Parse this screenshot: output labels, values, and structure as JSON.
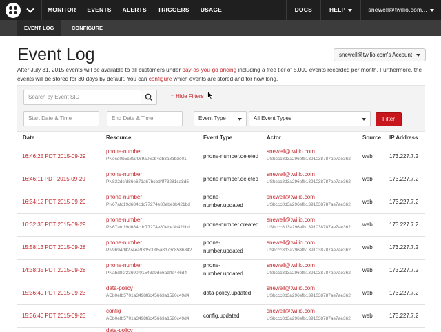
{
  "nav": {
    "items": [
      "MONITOR",
      "EVENTS",
      "ALERTS",
      "TRIGGERS",
      "USAGE"
    ],
    "docs": "DOCS",
    "help": "HELP",
    "user": "snewell@twilio.com..."
  },
  "subnav": {
    "event_log": "EVENT LOG",
    "configure": "CONFIGURE"
  },
  "page": {
    "title": "Event Log",
    "account_button": "snewell@twilio.com's Account",
    "desc_1": "After July 31, 2015 events will be available to all customers under ",
    "desc_link_1": "pay-as-you-go pricing",
    "desc_2": " including a free tier of 5,000 events recorded per month. Furthermore, the events will be stored for 30 days by default. You can ",
    "desc_link_2": "configure",
    "desc_3": " which events are stored and for how long."
  },
  "filters": {
    "search_placeholder": "Search by Event SID",
    "hide_filters": "Hide Filters",
    "start_placeholder": "Start Date & Time",
    "end_placeholder": "End Date & Time",
    "event_type_label": "Event Type",
    "event_type_value": "All Event Types",
    "filter_button": "Filter"
  },
  "table": {
    "headers": [
      "Date",
      "Resource",
      "Event Type",
      "Actor",
      "Source",
      "IP Address"
    ],
    "rows": [
      {
        "date": "16:46:25 PDT 2015-09-29",
        "res": "phone-number",
        "res_sid": "PNecd0b5c8faf969a060b4db3a8abde01",
        "type1": "phone-number.deleted",
        "type2": "",
        "actor": "snewell@twilio.com",
        "actor_sid": "USbccc8d3a296efb1391038787ae7ae362",
        "source": "web",
        "ip": "173.227.7.2"
      },
      {
        "date": "16:46:11 PDT 2015-09-29",
        "res": "phone-number",
        "res_sid": "PN832dcfd86e671a67bcbd4f73281ca8d5",
        "type1": "phone-number.deleted",
        "type2": "",
        "actor": "snewell@twilio.com",
        "actor_sid": "USbccc8d3a296efb1391038787ae7ae362",
        "source": "web",
        "ip": "173.227.7.2"
      },
      {
        "date": "16:34:12 PDT 2015-09-29",
        "res": "phone-number",
        "res_sid": "PN67afc19d684cdc77274e80ebe3b421bd",
        "type1": "phone-",
        "type2": "number.updated",
        "actor": "snewell@twilio.com",
        "actor_sid": "USbccc8d3a296efb1391038787ae7ae362",
        "source": "web",
        "ip": "173.227.7.2"
      },
      {
        "date": "16:32:36 PDT 2015-09-29",
        "res": "phone-number",
        "res_sid": "PN67afc19d684cdc77274e80ebe3b421bd",
        "type1": "phone-number.created",
        "type2": "",
        "actor": "snewell@twilio.com",
        "actor_sid": "USbccc8d3a296efb1391038787ae7ae362",
        "source": "web",
        "ip": "173.227.7.2"
      },
      {
        "date": "15:58:13 PDT 2015-09-28",
        "res": "phone-number",
        "res_sid": "PN9694d4274ea93d50005a8d73c8586342",
        "type1": "phone-",
        "type2": "number.updated",
        "actor": "snewell@twilio.com",
        "actor_sid": "USbccc8d3a296efb1391038787ae7ae362",
        "source": "web",
        "ip": "173.227.7.2"
      },
      {
        "date": "14:38:35 PDT 2015-09-28",
        "res": "phone-number",
        "res_sid": "PNabd8cf23690f01543a9de6ad4e446d4",
        "type1": "phone-",
        "type2": "number.updated",
        "actor": "snewell@twilio.com",
        "actor_sid": "USbccc8d3a296efb1391038787ae7ae362",
        "source": "web",
        "ip": "173.227.7.2"
      },
      {
        "date": "15:36:40 PDT 2015-09-23",
        "res": "data-policy",
        "res_sid": "ACb0efb5701a3498f6c45663a1520c49d4",
        "type1": "data-policy.updated",
        "type2": "",
        "actor": "snewell@twilio.com",
        "actor_sid": "USbccc8d3a296efb1391038787ae7ae362",
        "source": "web",
        "ip": "173.227.7.2"
      },
      {
        "date": "15:36:40 PDT 2015-09-23",
        "res": "config",
        "res_sid": "ACb0efb5701a3498f6c45663a1520c49d4",
        "type1": "config.updated",
        "type2": "",
        "actor": "snewell@twilio.com",
        "actor_sid": "USbccc8d3a296efb1391038787ae7ae362",
        "source": "web",
        "ip": "173.227.7.2"
      },
      {
        "date": "",
        "res": "data-policy",
        "res_sid": "",
        "type1": "",
        "type2": "",
        "actor": "",
        "actor_sid": "",
        "source": "",
        "ip": ""
      }
    ]
  },
  "colors": {
    "accent": "#c2262b",
    "nav_bg": "#1f1f1f",
    "subnav_bg": "#3c3c3c",
    "filter_red": "#c8161d"
  }
}
